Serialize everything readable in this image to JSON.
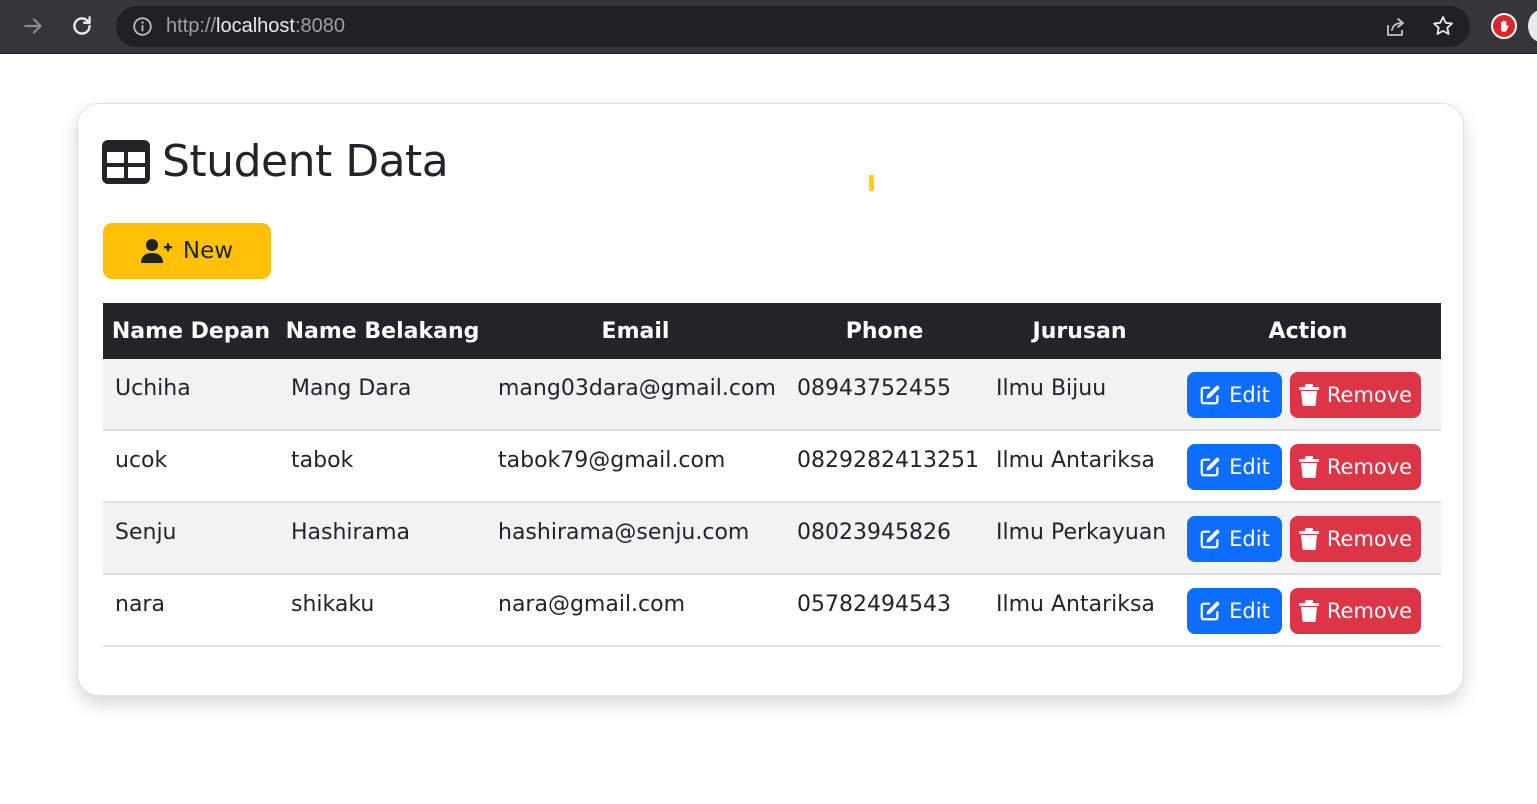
{
  "browser": {
    "url_scheme": "http://",
    "url_host": "localhost",
    "url_port": ":8080"
  },
  "page": {
    "title": "Student Data",
    "new_button_label": "New"
  },
  "table": {
    "headers": [
      "Name Depan",
      "Name Belakang",
      "Email",
      "Phone",
      "Jurusan",
      "Action"
    ],
    "rows": [
      {
        "first": "Uchiha",
        "last": "Mang Dara",
        "email": "mang03dara@gmail.com",
        "phone": "08943752455",
        "jurusan": "Ilmu Bijuu"
      },
      {
        "first": "ucok",
        "last": "tabok",
        "email": "tabok79@gmail.com",
        "phone": "0829282413251",
        "jurusan": "Ilmu Antariksa"
      },
      {
        "first": "Senju",
        "last": "Hashirama",
        "email": "hashirama@senju.com",
        "phone": "08023945826",
        "jurusan": "Ilmu Perkayuan"
      },
      {
        "first": "nara",
        "last": "shikaku",
        "email": "nara@gmail.com",
        "phone": "05782494543",
        "jurusan": "Ilmu Antariksa"
      }
    ],
    "edit_label": "Edit",
    "remove_label": "Remove"
  },
  "colors": {
    "new_button": "#ffc107",
    "edit_button": "#0d6efd",
    "remove_button": "#dc3545",
    "table_header": "#212529"
  },
  "icons": {
    "title": "table-icon",
    "new": "user-plus-icon",
    "edit": "edit-icon",
    "remove": "trash-icon"
  }
}
